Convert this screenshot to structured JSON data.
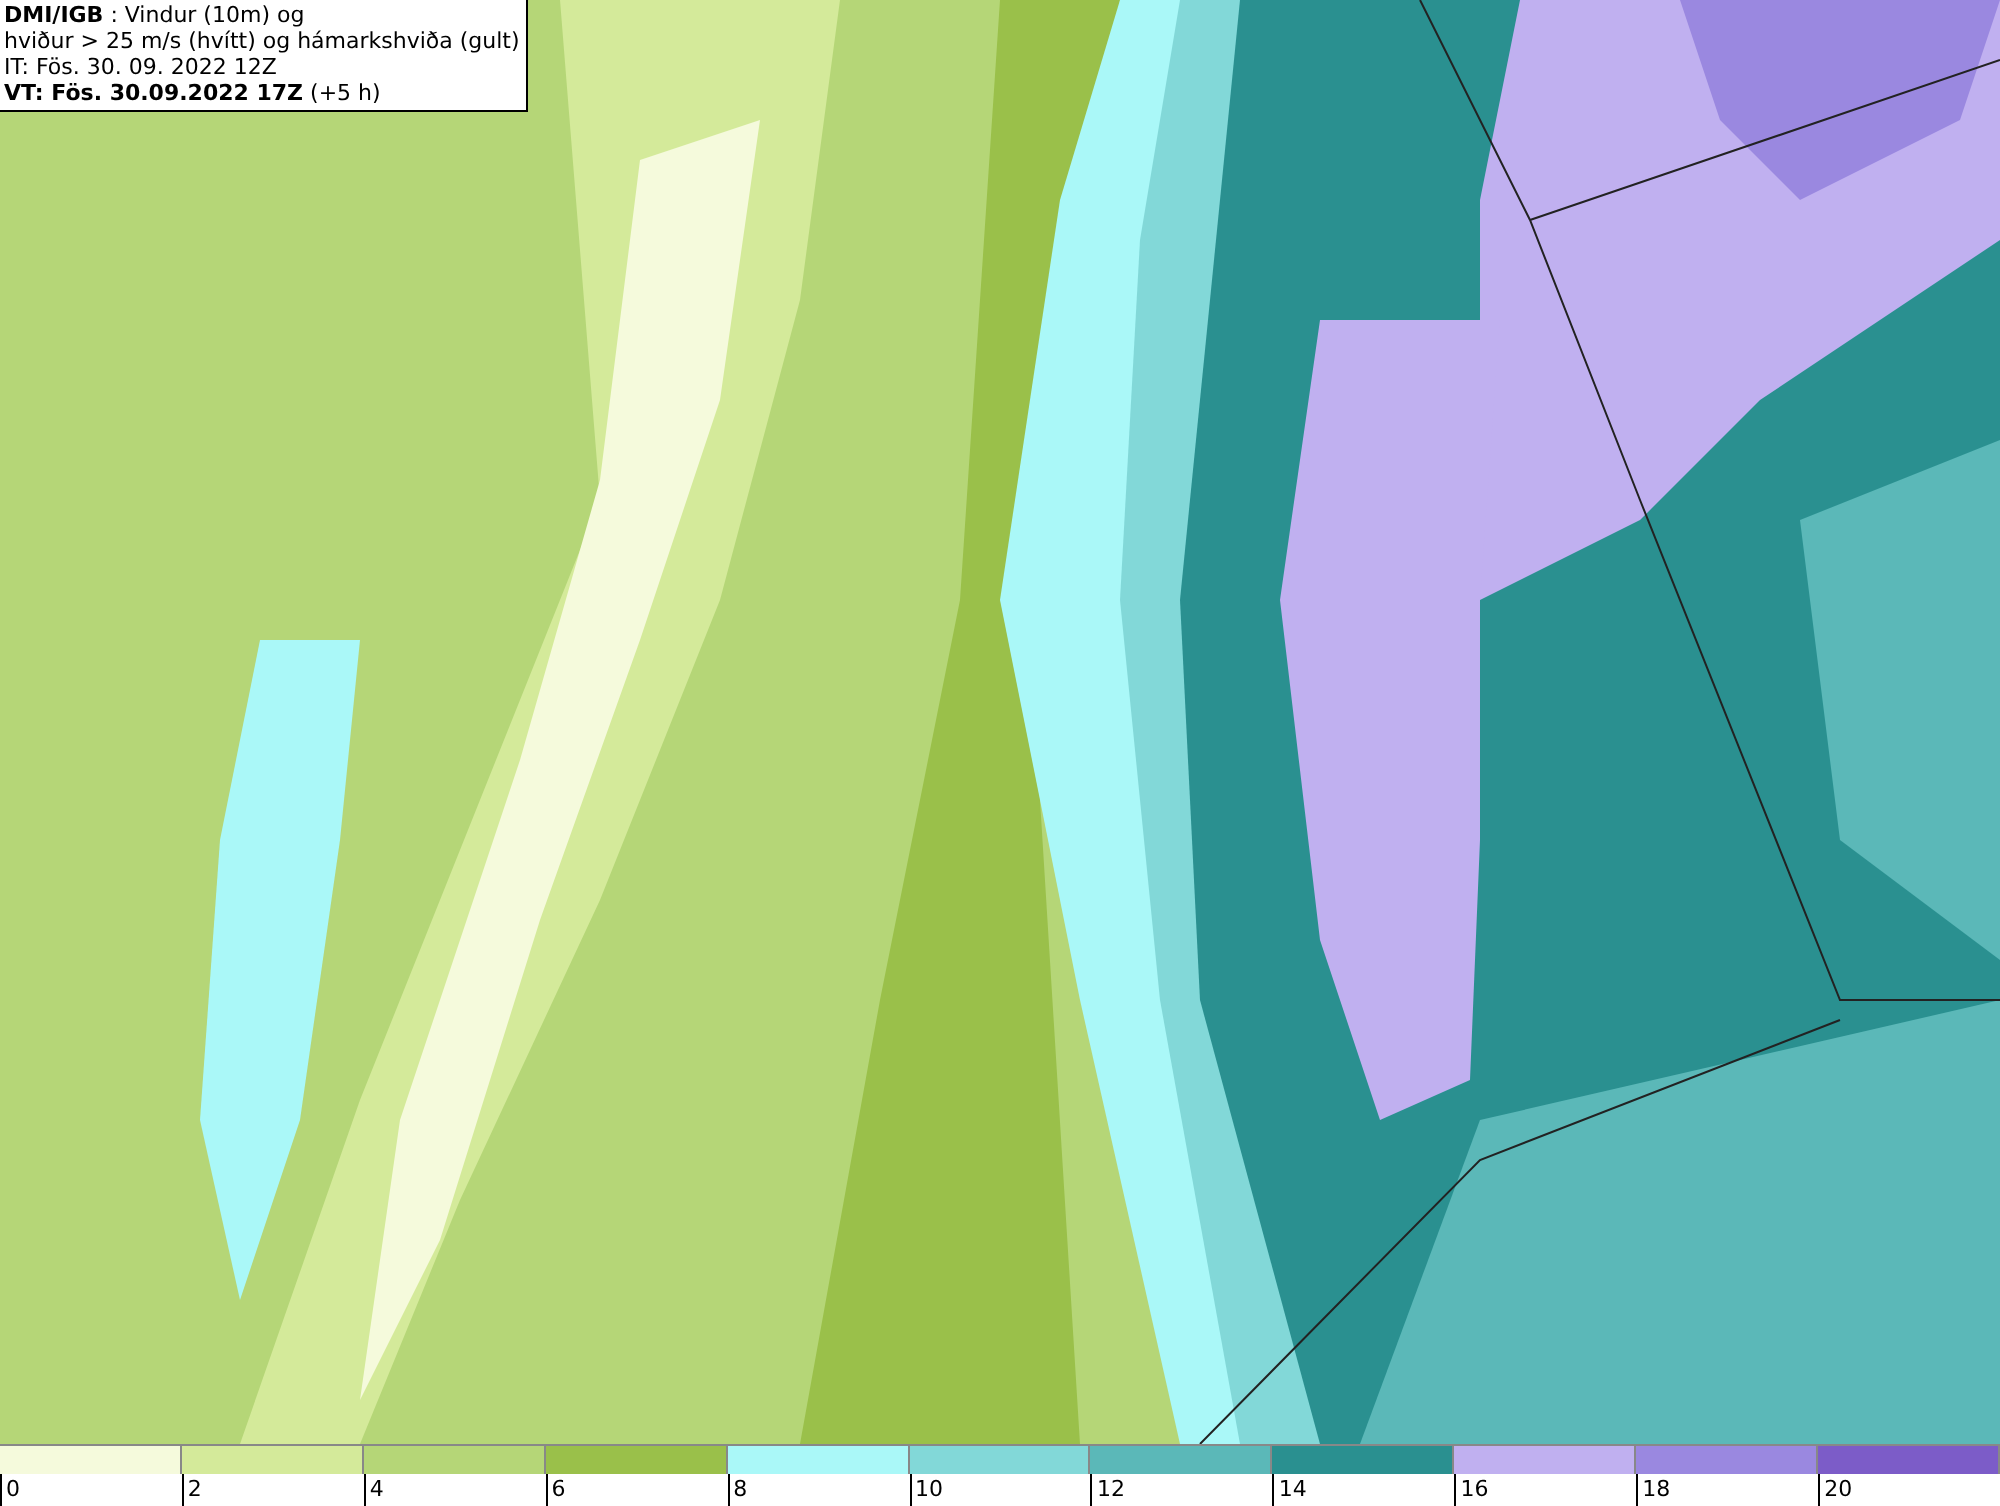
{
  "header": {
    "lines": [
      "**DMI/IGB** : Vindur (10m) og",
      "hviður > 25 m/s (hvítt) og hámarkshviða (gult)",
      "IT: Fös. 30. 09. 2022 12Z",
      "**VT: Fös. 30.09.2022 17Z** (+5 h)"
    ]
  },
  "legend": {
    "bins": [
      {
        "label": "0",
        "color": "#f5fadc"
      },
      {
        "label": "2",
        "color": "#d4ea9a"
      },
      {
        "label": "4",
        "color": "#b5d677"
      },
      {
        "label": "6",
        "color": "#9ac04a"
      },
      {
        "label": "8",
        "color": "#aaf8f8"
      },
      {
        "label": "10",
        "color": "#82d8d8"
      },
      {
        "label": "12",
        "color": "#5bb8b8"
      },
      {
        "label": "14",
        "color": "#2a9090"
      },
      {
        "label": "16",
        "color": "#c0b0f0"
      },
      {
        "label": "18",
        "color": "#9a88e0"
      },
      {
        "label": "20",
        "color": "#7c5cc8"
      }
    ]
  }
}
